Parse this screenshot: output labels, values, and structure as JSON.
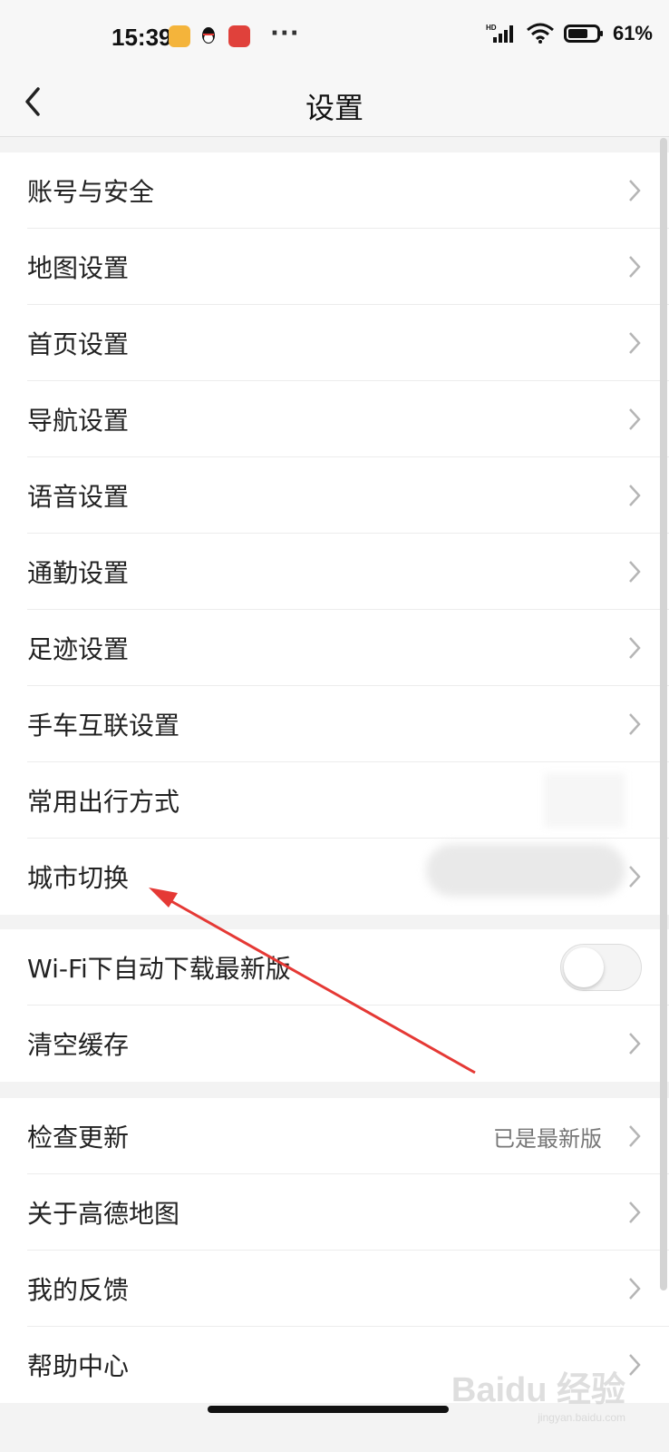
{
  "status_bar": {
    "time": "15:39",
    "more": "···",
    "battery": "61%",
    "icons": [
      "notes-app-icon",
      "qq-icon",
      "app-icon",
      "hd-signal-icon",
      "wifi-icon",
      "battery-icon"
    ]
  },
  "nav": {
    "title": "设置",
    "back_icon": "chevron-left-icon"
  },
  "groups": [
    {
      "items": [
        {
          "label": "账号与安全"
        },
        {
          "label": "地图设置"
        },
        {
          "label": "首页设置"
        },
        {
          "label": "导航设置"
        },
        {
          "label": "语音设置"
        },
        {
          "label": "通勤设置"
        },
        {
          "label": "足迹设置"
        },
        {
          "label": "手车互联设置"
        },
        {
          "label": "常用出行方式"
        },
        {
          "label": "城市切换"
        }
      ]
    },
    {
      "items": [
        {
          "label": "Wi-Fi下自动下载最新版",
          "toggle": false
        },
        {
          "label": "清空缓存"
        }
      ]
    },
    {
      "items": [
        {
          "label": "检查更新",
          "value": "已是最新版"
        },
        {
          "label": "关于高德地图"
        },
        {
          "label": "我的反馈"
        },
        {
          "label": "帮助中心"
        }
      ]
    }
  ],
  "watermark": {
    "text": "Baidu 经验",
    "sub": "jingyan.baidu.com"
  },
  "colors": {
    "annotation_arrow": "#e53935",
    "background": "#f3f3f3",
    "row": "#ffffff"
  }
}
